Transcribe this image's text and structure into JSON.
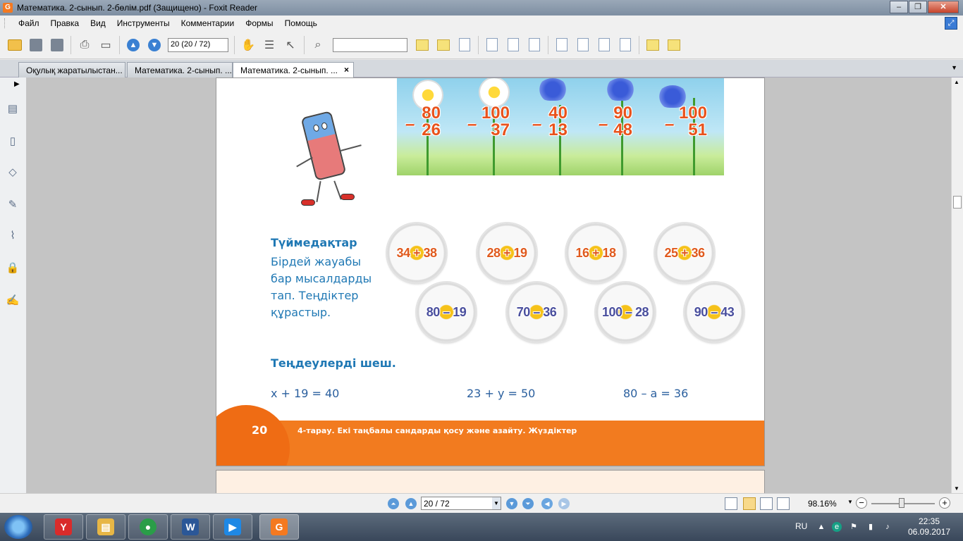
{
  "window": {
    "title": "Математика. 2-сынып. 2-бөлім.pdf (Защищено) - Foxit Reader",
    "app_icon_letter": "G"
  },
  "menu": [
    "Файл",
    "Правка",
    "Вид",
    "Инструменты",
    "Комментарии",
    "Формы",
    "Помощь"
  ],
  "toolbar": {
    "page_field_value": "20 (20 / 72)",
    "search_field_value": ""
  },
  "tabs": [
    {
      "label": "Оқулық жаратылыстан...",
      "active": false
    },
    {
      "label": "Математика. 2-сынып. ...",
      "active": false
    },
    {
      "label": "Математика. 2-сынып. ...",
      "active": true,
      "close": "×"
    }
  ],
  "page": {
    "subtractions": [
      {
        "top": "80",
        "bottom": "26",
        "sign": "–"
      },
      {
        "top": "100",
        "bottom": "37",
        "sign": "–"
      },
      {
        "top": "40",
        "bottom": "13",
        "sign": "–"
      },
      {
        "top": "90",
        "bottom": "48",
        "sign": "–"
      },
      {
        "top": "100",
        "bottom": "51",
        "sign": "–"
      }
    ],
    "task1": {
      "title": "Түймедақтар",
      "text": "Бірдей жауабы бар мысалдарды тап. Теңдіктер құрастыр."
    },
    "plus_daisies": [
      "34 + 38",
      "28 + 19",
      "16 + 18",
      "25 + 36"
    ],
    "minus_daisies": [
      "80 – 19",
      "70 – 36",
      "100 – 28",
      "90 – 43"
    ],
    "task2": {
      "title": "Теңдеулерді шеш.",
      "equations": [
        "x + 19 = 40",
        "23 + y = 50",
        "80 – a = 36"
      ]
    },
    "footer": {
      "page_number": "20",
      "chapter": "4-тарау. Екі таңбалы сандарды қосу және азайту. Жүздіктер"
    }
  },
  "nav": {
    "page_value": "20 / 72",
    "zoom": "98.16%",
    "zoom_minus": "−",
    "zoom_plus": "+"
  },
  "taskbar": {
    "lang": "RU",
    "time": "22:35",
    "date": "06.09.2017",
    "apps": [
      {
        "name": "yandex-browser",
        "glyph": "Y",
        "color": "#d92b2b"
      },
      {
        "name": "file-explorer",
        "glyph": "▤",
        "color": "#e7b645"
      },
      {
        "name": "chrome",
        "glyph": "●",
        "color": "#2a9d48"
      },
      {
        "name": "word",
        "glyph": "W",
        "color": "#2b5797"
      },
      {
        "name": "media-player",
        "glyph": "▶",
        "color": "#1e88e5"
      },
      {
        "name": "foxit-reader",
        "glyph": "G",
        "color": "#f47920"
      }
    ]
  },
  "colors": {
    "accent_orange": "#f27b1f",
    "task_blue": "#1f78b4",
    "plus_color": "#e05a1e",
    "minus_color": "#4a4f9e"
  }
}
